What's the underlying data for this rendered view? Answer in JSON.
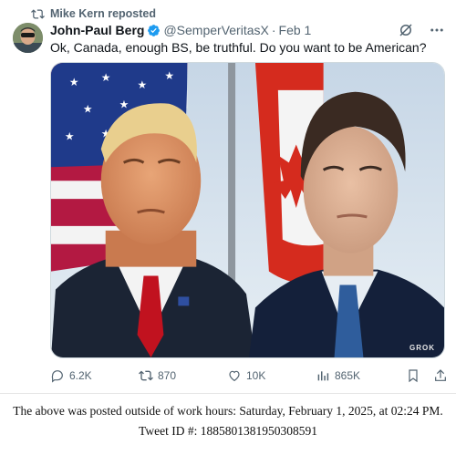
{
  "repost": {
    "text": "Mike Kern reposted",
    "icon": "repost-icon"
  },
  "author": {
    "name": "John-Paul Berg",
    "handle": "@SemperVeritasX",
    "separator": "·",
    "date": "Feb 1",
    "verified_icon": "verified-badge-icon",
    "avatar_icon": "avatar"
  },
  "tweet": {
    "text": "Ok, Canada, enough BS, be truthful. Do you want to be American?"
  },
  "media": {
    "watermark": "GROK"
  },
  "actions": {
    "replies": "6.2K",
    "reposts": "870",
    "likes": "10K",
    "views": "865K"
  },
  "footer": {
    "line1": "The above was posted outside of work hours: Saturday, February 1, 2025, at 02:24 PM.",
    "line2": "Tweet ID #: 1885801381950308591"
  },
  "colors": {
    "accent": "#1d9bf0",
    "muted": "#536471",
    "text": "#0f1419"
  }
}
